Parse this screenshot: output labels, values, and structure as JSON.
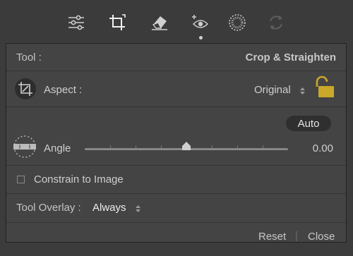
{
  "toolbar": {
    "tools": [
      {
        "name": "sliders-icon"
      },
      {
        "name": "crop-icon",
        "active": true
      },
      {
        "name": "eraser-icon"
      },
      {
        "name": "red-eye-icon"
      },
      {
        "name": "radial-filter-icon"
      },
      {
        "name": "refresh-icon",
        "disabled": true
      }
    ]
  },
  "panel": {
    "tool_label": "Tool :",
    "tool_value": "Crop & Straighten",
    "aspect_label": "Aspect :",
    "aspect_value": "Original",
    "auto_label": "Auto",
    "angle_label": "Angle",
    "angle_value": "0.00",
    "constrain_label": "Constrain to Image",
    "overlay_label": "Tool Overlay :",
    "overlay_value": "Always",
    "reset_label": "Reset",
    "separator": "|",
    "close_label": "Close"
  },
  "colors": {
    "background": "#3c3c3c",
    "panel": "#444444",
    "lock": "#c9a82a"
  }
}
